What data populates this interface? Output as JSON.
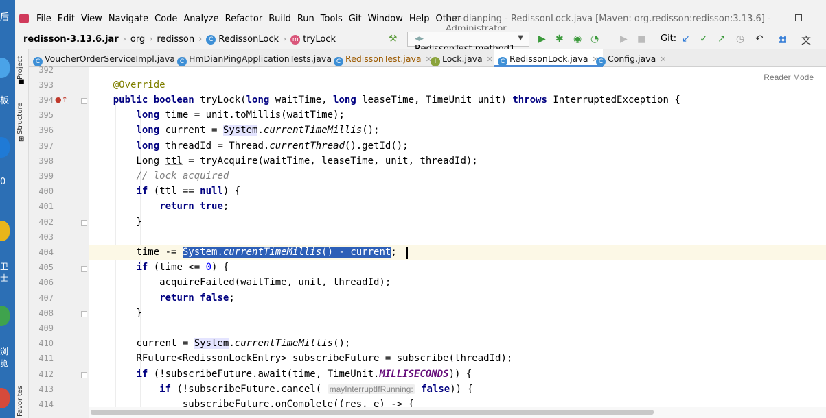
{
  "desktop": {
    "labels": [
      "后",
      "板",
      "0",
      "卫士",
      "浏览"
    ]
  },
  "menubar": {
    "items": [
      "File",
      "Edit",
      "View",
      "Navigate",
      "Code",
      "Analyze",
      "Refactor",
      "Build",
      "Run",
      "Tools",
      "Git",
      "Window",
      "Help",
      "Other"
    ],
    "title": "hm-dianping - RedissonLock.java [Maven: org.redisson:redisson:3.13.6] - Administrator"
  },
  "navbar": {
    "crumbs": [
      "redisson-3.13.6.jar",
      "org",
      "redisson",
      "RedissonLock",
      "tryLock"
    ],
    "run_config": "RedissonTest.method1",
    "git_label": "Git:"
  },
  "tabs": [
    {
      "label": "VoucherOrderServiceImpl.java",
      "icon": "C",
      "color": "#3d8fd6",
      "active": false
    },
    {
      "label": "HmDianPingApplicationTests.java",
      "icon": "C",
      "color": "#3d8fd6",
      "active": false
    },
    {
      "label": "RedissonTest.java",
      "icon": "C",
      "color": "#3d8fd6",
      "active": false
    },
    {
      "label": "Lock.java",
      "icon": "I",
      "color": "#8aa33b",
      "active": false
    },
    {
      "label": "RedissonLock.java",
      "icon": "C",
      "color": "#3d8fd6",
      "active": true
    },
    {
      "label": "Config.java",
      "icon": "C",
      "color": "#3d8fd6",
      "active": false
    }
  ],
  "sidebar": {
    "project": "Project",
    "structure": "Structure",
    "favorites": "Favorites"
  },
  "editor": {
    "reader_mode": "Reader Mode",
    "param_hint": "mayInterruptIfRunning:",
    "lines": [
      392,
      393,
      394,
      395,
      396,
      397,
      398,
      399,
      400,
      401,
      402,
      403,
      404,
      405,
      406,
      407,
      408,
      409,
      410,
      411,
      412,
      413,
      414
    ]
  }
}
